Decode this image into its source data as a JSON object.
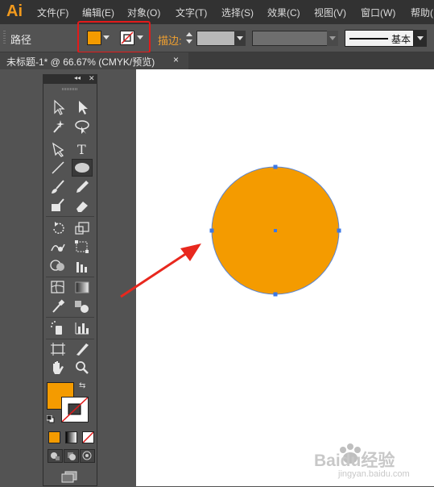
{
  "app": {
    "logo": "Ai"
  },
  "menu": {
    "items": [
      "文件(F)",
      "编辑(E)",
      "对象(O)",
      "文字(T)",
      "选择(S)",
      "效果(C)",
      "视图(V)",
      "窗口(W)",
      "帮助("
    ]
  },
  "control_bar": {
    "selection_label": "路径",
    "fill_color": "#f49b00",
    "stroke_label": "描边:",
    "brush_style_label": "基本"
  },
  "document_tab": {
    "title": "未标题-1* @ 66.67% (CMYK/预览)",
    "close_glyph": "×"
  },
  "tools_panel": {
    "collapse_glyph": "◂◂",
    "close_glyph": "✕",
    "fill_swatch_color": "#f49b00",
    "tools": [
      "selection",
      "direct-selection",
      "magic-wand",
      "lasso",
      "pen",
      "type",
      "line-segment",
      "ellipse",
      "paintbrush",
      "pencil",
      "blob-brush",
      "eraser",
      "rotate",
      "scale",
      "warp",
      "free-transform",
      "shape-builder",
      "graph",
      "mesh",
      "gradient",
      "eyedropper",
      "blend",
      "symbol-sprayer",
      "column-graph",
      "artboard",
      "slice",
      "hand",
      "zoom"
    ]
  },
  "canvas": {
    "shape": "circle",
    "fill": "#f49b00",
    "anchor_color": "#3b78e7"
  },
  "watermark": {
    "text": "Baidu经验",
    "subtext": "jingyan.baidu.com"
  }
}
